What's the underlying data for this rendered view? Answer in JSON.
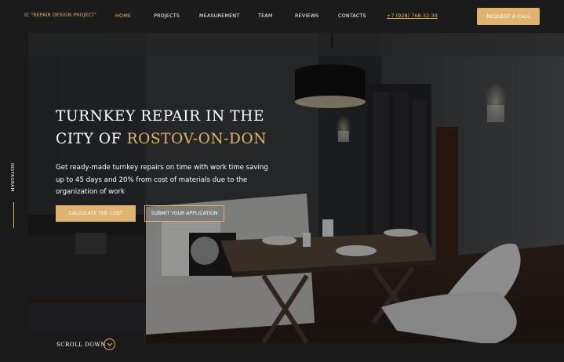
{
  "header": {
    "logo": "IC \"REPAIR DESIGN PROJECT\"",
    "nav": [
      "HOME",
      "PROJECTS",
      "MEASUREMENT",
      "TEAM",
      "REVIEWS",
      "CONTACTS"
    ],
    "phone": "+7 (928) 768-32-39",
    "request_button": "REQUEST A CALL"
  },
  "side": {
    "instagram": "INSTAGRAM"
  },
  "hero": {
    "title_line1": "TURNKEY REPAIR IN THE",
    "title_line2_prefix": "CITY OF ",
    "title_line2_accent": "ROSTOV-ON-DON",
    "subtitle": "Get ready-made turnkey repairs on time with work time saving up to 45 days and 20% from cost of materials due to the organization of work",
    "calc_button": "CALCULATE THE COST",
    "submit_button": "SUBMIT YOUR APPLICATION"
  },
  "scroll": {
    "label": "SCROLL DOWN"
  },
  "colors": {
    "accent": "#dfb471",
    "dark": "#1b1b1b"
  },
  "icons": {
    "scroll": "chevron-down-icon"
  }
}
